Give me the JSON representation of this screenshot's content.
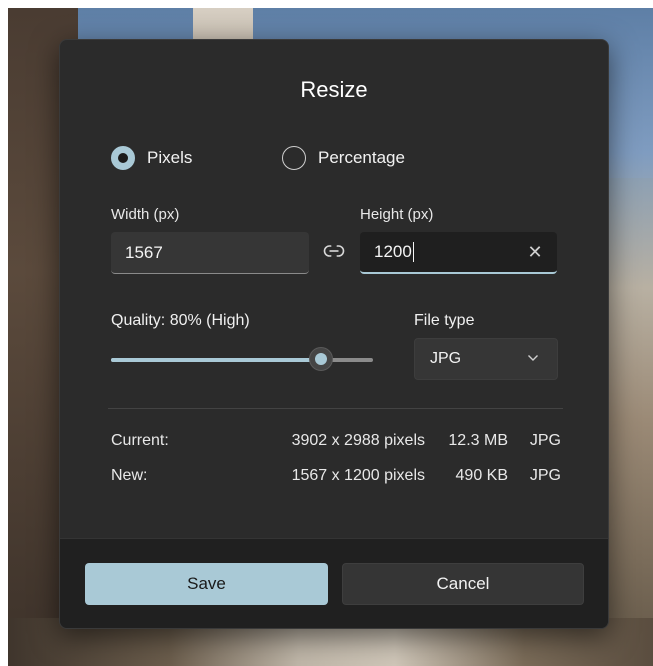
{
  "dialog": {
    "title": "Resize",
    "modes": [
      {
        "label": "Pixels",
        "selected": true
      },
      {
        "label": "Percentage",
        "selected": false
      }
    ],
    "width": {
      "label": "Width  (px)",
      "value": "1567"
    },
    "height": {
      "label": "Height  (px)",
      "value": "1200"
    },
    "quality": {
      "label": "Quality: 80% (High)",
      "value_percent": 80
    },
    "file_type": {
      "label": "File type",
      "selected": "JPG"
    },
    "info": {
      "current": {
        "label": "Current:",
        "dimensions": "3902 x 2988 pixels",
        "size": "12.3 MB",
        "type": "JPG"
      },
      "new": {
        "label": "New:",
        "dimensions": "1567 x 1200 pixels",
        "size": "490 KB",
        "type": "JPG"
      }
    },
    "buttons": {
      "save": "Save",
      "cancel": "Cancel"
    }
  },
  "colors": {
    "accent": "#a9c9d6",
    "dialog_bg": "#2b2b2b",
    "footer_bg": "#202020"
  },
  "icons": {
    "link": "link-icon",
    "clear": "close-icon",
    "dropdown": "chevron-down-icon"
  }
}
